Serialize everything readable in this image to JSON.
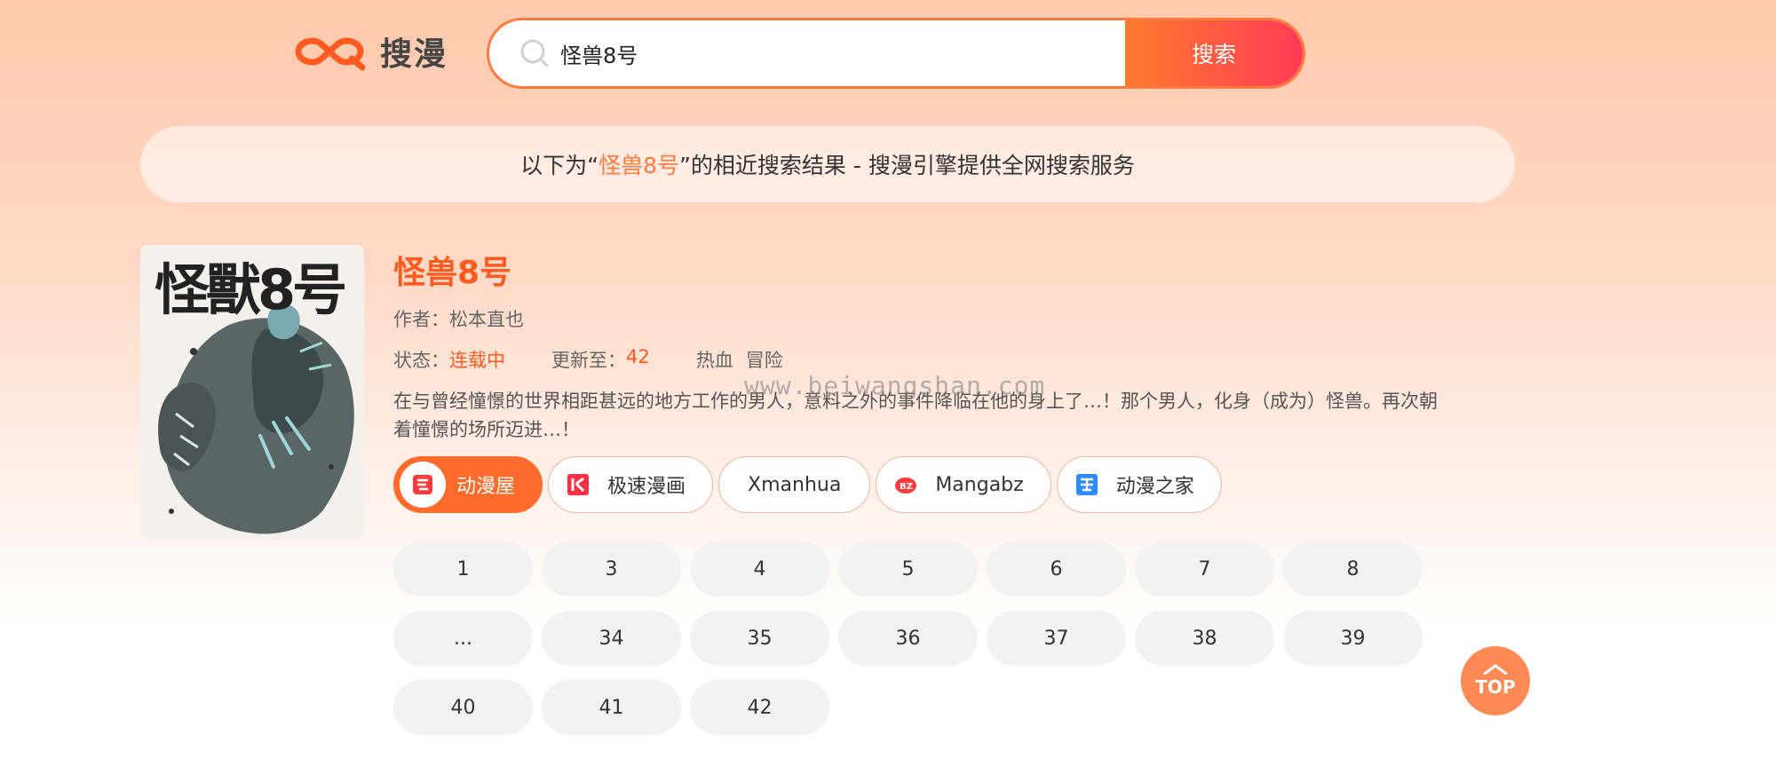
{
  "header": {
    "logo_text": "搜漫",
    "search": {
      "value": "怪兽8号",
      "button_label": "搜索"
    }
  },
  "notice": {
    "prefix": "以下为“",
    "keyword": "怪兽8号",
    "suffix": "”的相近搜索结果 - 搜漫引擎提供全网搜索服务"
  },
  "result": {
    "cover_title": "怪獸8号",
    "title": "怪兽8号",
    "author": "作者：松本直也",
    "status_label": "状态：",
    "status_value": "连载中",
    "update_label": "更新至：",
    "update_value": "42",
    "tags": [
      "热血",
      "冒险"
    ],
    "description": "在与曾经憧憬的世界相距甚远的地方工作的男人，意料之外的事件降临在他的身上了…！那个男人，化身（成为）怪兽。再次朝着憧憬的场所迈进…！",
    "sources": [
      {
        "label": "动漫屋",
        "icon": "dmzj-house-icon",
        "active": true
      },
      {
        "label": "极速漫画",
        "icon": "jisu-icon",
        "active": false
      },
      {
        "label": "Xmanhua",
        "icon": "",
        "active": false
      },
      {
        "label": "Mangabz",
        "icon": "mangabz-icon",
        "active": false
      },
      {
        "label": "动漫之家",
        "icon": "manhua-home-icon",
        "active": false
      }
    ],
    "chapters": [
      "1",
      "3",
      "4",
      "5",
      "6",
      "7",
      "8",
      "...",
      "34",
      "35",
      "36",
      "37",
      "38",
      "39",
      "40",
      "41",
      "42"
    ]
  },
  "watermark": "www.beiwangshan.com",
  "top_button_label": "TOP",
  "colors": {
    "accent": "#ff5a1f",
    "button_gradient_start": "#ff7a2e",
    "button_gradient_end": "#ff3b55"
  }
}
